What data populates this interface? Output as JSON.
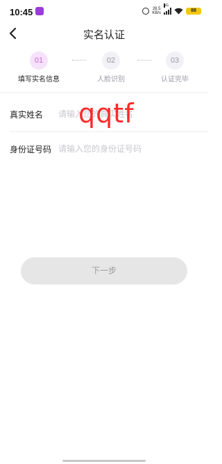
{
  "status_bar": {
    "time": "10:45",
    "network_speed_value": "26.5",
    "network_speed_unit": "KB/s",
    "signal_label": "5G",
    "battery": "88"
  },
  "header": {
    "title": "实名认证",
    "back_icon": "chevron-left-icon"
  },
  "steps": [
    {
      "number": "01",
      "label": "填写实名信息",
      "active": true
    },
    {
      "number": "02",
      "label": "人脸识别",
      "active": false
    },
    {
      "number": "03",
      "label": "认证完毕",
      "active": false
    }
  ],
  "form": {
    "name_label": "真实姓名",
    "name_placeholder": "请输入您的真实姓名",
    "name_handwritten": "qqtf",
    "id_label": "身份证号码",
    "id_placeholder": "请输入您的身份证号码"
  },
  "actions": {
    "next_label": "下一步"
  },
  "colors": {
    "accent": "#c86ad8",
    "accent_bg": "#f6e2fb",
    "annotation": "#ff2a2a",
    "button_disabled_bg": "#e6e6e6"
  }
}
